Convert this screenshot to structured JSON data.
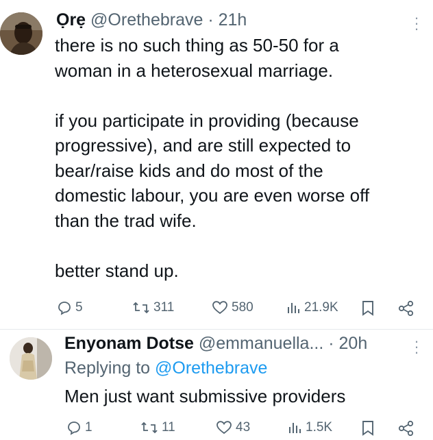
{
  "tweets": [
    {
      "display_name": "Ọrẹ",
      "handle": "@Orethebrave",
      "separator": "·",
      "time": "21h",
      "paragraphs": [
        [
          "there is no such thing as 50-50 for a",
          "woman in a heterosexual marriage."
        ],
        [
          "if you participate in providing (because",
          "progressive), and are still expected to",
          "bear/raise kids and do most of the",
          "domestic labour, you are even worse off",
          "than the trad wife."
        ],
        [
          "better stand up."
        ]
      ],
      "metrics": {
        "replies": "5",
        "reposts": "311",
        "likes": "580",
        "views": "21.9K"
      }
    },
    {
      "display_name": "Enyonam Dotse",
      "handle": "@emmanuella...",
      "separator": "·",
      "time": "20h",
      "replying_label": "Replying to",
      "replying_to": "@Orethebrave",
      "text": "Men just want submissive providers",
      "metrics": {
        "replies": "1",
        "reposts": "11",
        "likes": "43",
        "views": "1.5K"
      }
    }
  ],
  "icons": {
    "reply": "reply-icon",
    "repost": "repost-icon",
    "like": "heart-icon",
    "views": "views-icon",
    "bookmark": "bookmark-icon",
    "share": "share-icon",
    "more": "more-options-icon"
  },
  "colors": {
    "text": "#0f1419",
    "secondary": "#536471",
    "link": "#1d9bf0",
    "divider": "#e6e9ec"
  }
}
